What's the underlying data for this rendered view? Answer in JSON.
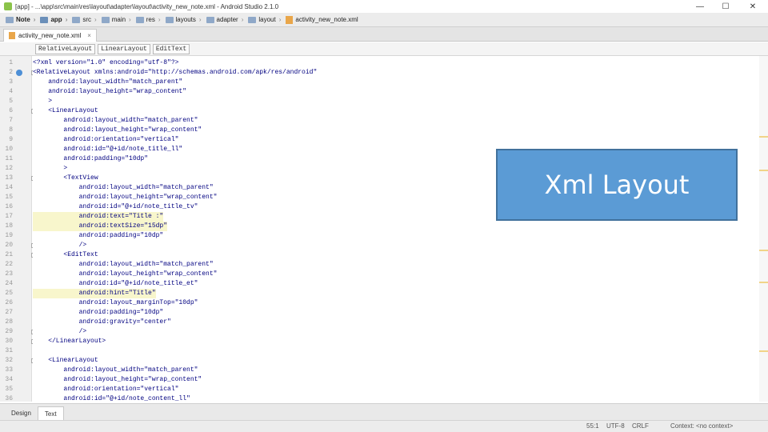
{
  "window": {
    "title": "[app] - ...\\app\\src\\main\\res\\layout\\adapter\\layout\\activity_new_note.xml - Android Studio 2.1.0",
    "minimize_glyph": "—",
    "maximize_glyph": "☐",
    "close_glyph": "✕"
  },
  "navbar": {
    "items": [
      {
        "label": "Note",
        "icon": "folder-icon"
      },
      {
        "label": "app",
        "icon": "module-folder-icon"
      },
      {
        "label": "src",
        "icon": "folder-icon"
      },
      {
        "label": "main",
        "icon": "folder-icon"
      },
      {
        "label": "res",
        "icon": "folder-icon"
      },
      {
        "label": "layouts",
        "icon": "folder-icon"
      },
      {
        "label": "adapter",
        "icon": "folder-icon"
      },
      {
        "label": "layout",
        "icon": "folder-icon"
      },
      {
        "label": "activity_new_note.xml",
        "icon": "xml-file-icon"
      }
    ]
  },
  "file_tab": {
    "label": "activity_new_note.xml",
    "close": "×"
  },
  "element_crumbs": [
    "RelativeLayout",
    "LinearLayout",
    "EditText"
  ],
  "editor": {
    "lines": [
      {
        "n": "1",
        "text": "<?xml version=\"1.0\" encoding=\"utf-8\"?>"
      },
      {
        "n": "2",
        "text": "<RelativeLayout xmlns:android=\"http://schemas.android.com/apk/res/android\""
      },
      {
        "n": "3",
        "text": "    android:layout_width=\"match_parent\""
      },
      {
        "n": "4",
        "text": "    android:layout_height=\"wrap_content\""
      },
      {
        "n": "5",
        "text": "    >"
      },
      {
        "n": "6",
        "text": "    <LinearLayout"
      },
      {
        "n": "7",
        "text": "        android:layout_width=\"match_parent\""
      },
      {
        "n": "8",
        "text": "        android:layout_height=\"wrap_content\""
      },
      {
        "n": "9",
        "text": "        android:orientation=\"vertical\""
      },
      {
        "n": "10",
        "text": "        android:id=\"@+id/note_title_ll\""
      },
      {
        "n": "11",
        "text": "        android:padding=\"10dp\""
      },
      {
        "n": "12",
        "text": "        >"
      },
      {
        "n": "13",
        "text": "        <TextView"
      },
      {
        "n": "14",
        "text": "            android:layout_width=\"match_parent\""
      },
      {
        "n": "15",
        "text": "            android:layout_height=\"wrap_content\""
      },
      {
        "n": "16",
        "text": "            android:id=\"@+id/note_title_tv\""
      },
      {
        "n": "17",
        "text": "            android:text=\"Title :\""
      },
      {
        "n": "18",
        "text": "            android:textSize=\"15dp\""
      },
      {
        "n": "19",
        "text": "            android:padding=\"10dp\""
      },
      {
        "n": "20",
        "text": "            />"
      },
      {
        "n": "21",
        "text": "        <EditText"
      },
      {
        "n": "22",
        "text": "            android:layout_width=\"match_parent\""
      },
      {
        "n": "23",
        "text": "            android:layout_height=\"wrap_content\""
      },
      {
        "n": "24",
        "text": "            android:id=\"@+id/note_title_et\""
      },
      {
        "n": "25",
        "text": "            android:hint=\"Title\""
      },
      {
        "n": "26",
        "text": "            android:layout_marginTop=\"10dp\""
      },
      {
        "n": "27",
        "text": "            android:padding=\"10dp\""
      },
      {
        "n": "28",
        "text": "            android:gravity=\"center\""
      },
      {
        "n": "29",
        "text": "            />"
      },
      {
        "n": "30",
        "text": "    </LinearLayout>"
      },
      {
        "n": "31",
        "text": ""
      },
      {
        "n": "32",
        "text": "    <LinearLayout"
      },
      {
        "n": "33",
        "text": "        android:layout_width=\"match_parent\""
      },
      {
        "n": "34",
        "text": "        android:layout_height=\"wrap_content\""
      },
      {
        "n": "35",
        "text": "        android:orientation=\"vertical\""
      },
      {
        "n": "36",
        "text": "        android:id=\"@+id/note_content_ll\""
      }
    ]
  },
  "bottom_tabs": [
    "Design",
    "Text"
  ],
  "status": {
    "position": "55:1",
    "encoding": "UTF-8",
    "line_sep": "CRLF",
    "context": "Context: <no context>"
  },
  "overlay": {
    "text": "Xml Layout"
  },
  "colors": {
    "overlay_fill": "#5b9bd5",
    "overlay_border": "#41719c",
    "highlight": "#f8f6cc",
    "code_text": "#000080",
    "scroll_mark": "#f1d488"
  }
}
